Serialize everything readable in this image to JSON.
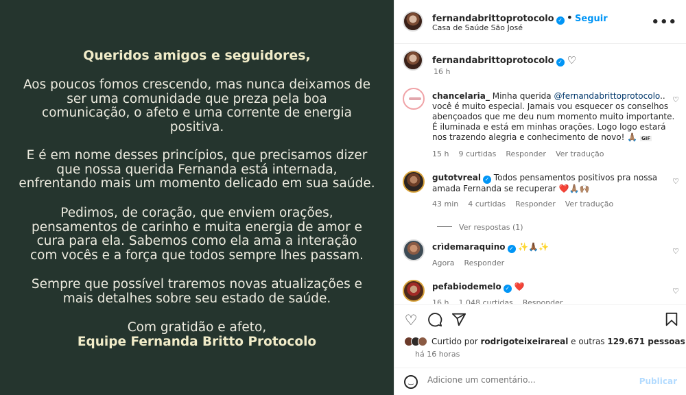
{
  "post_image": {
    "greeting": "Queridos amigos e seguidores,",
    "paragraph1": [
      "Aos poucos fomos crescendo, mas nunca deixamos de",
      "ser uma comunidade que preza pela boa",
      "comunicação, o afeto e uma corrente de energia",
      "positiva."
    ],
    "paragraph2": [
      "E é em nome desses princípios, que precisamos dizer",
      "que nossa querida Fernanda está internada,",
      "enfrentando mais um momento delicado em sua saúde."
    ],
    "paragraph3": [
      "Pedimos, de coração, que enviem orações,",
      "pensamentos de carinho e muita energia de amor e",
      "cura para ela. Sabemos como ela ama a interação",
      "com vocês e a força que todos sempre lhes passam."
    ],
    "paragraph4": [
      "Sempre que possível traremos novas atualizações e",
      "mais detalhes sobre seu estado de saúde."
    ],
    "closing": "Com gratidão e afeto,",
    "team": "Equipe Fernanda Britto Protocolo"
  },
  "header": {
    "username": "fernandabrittoprotocolo",
    "separator": "•",
    "follow_label": "Seguir",
    "location": "Casa de Saúde São José",
    "more_icon": "more-horizontal-icon",
    "verified_glyph": "✓"
  },
  "caption": {
    "username": "fernandabrittoprotocolo",
    "time": "16 h",
    "heart_glyph": "♡"
  },
  "comments": [
    {
      "username": "chancelaria_",
      "mention": "@fernandabrittoprotocolo",
      "text_before": "Minha querida",
      "text_after": "..",
      "lines": [
        "você é muito especial. Jamais vou esquecer os conselhos",
        "abençoados que me deu num momento muito importante.",
        "É iluminada e está em minhas orações. Logo logo estará",
        "nos trazendo alegria e conhecimento de novo! 🙏🏽"
      ],
      "gif_label": "GIF",
      "time": "15 h",
      "likes": "9 curtidas",
      "reply": "Responder",
      "translate": "Ver tradução"
    },
    {
      "username": "gutotvreal",
      "text_line1": "Todos pensamentos positivos pra nossa",
      "text_line2": "amada Fernanda se recuperar",
      "emojis": "❤️🙏🏽🙌🏽",
      "time": "43 min",
      "likes": "4 curtidas",
      "reply": "Responder",
      "translate": "Ver tradução",
      "view_replies": "Ver respostas (1)"
    },
    {
      "username": "crìdemaraquino",
      "emojis": "✨🙏🏾✨",
      "time": "Agora",
      "reply": "Responder"
    },
    {
      "username": "pefabiodemelo",
      "emojis": "❤️",
      "time": "16 h",
      "likes": "1.048 curtidas",
      "reply": "Responder"
    }
  ],
  "actions": {
    "liked_by_prefix": "Curtido por",
    "liked_by_user": "rodrigoteixeirareal",
    "liked_by_suffix": "e outras",
    "liked_count": "129.671 pessoas",
    "time": "há 16 horas",
    "comment_placeholder": "Adicione um comentário...",
    "publish_label": "Publicar"
  },
  "colors": {
    "image_background": "#25352e",
    "link_blue": "#0095f6",
    "heart_red": "#e0245e"
  }
}
